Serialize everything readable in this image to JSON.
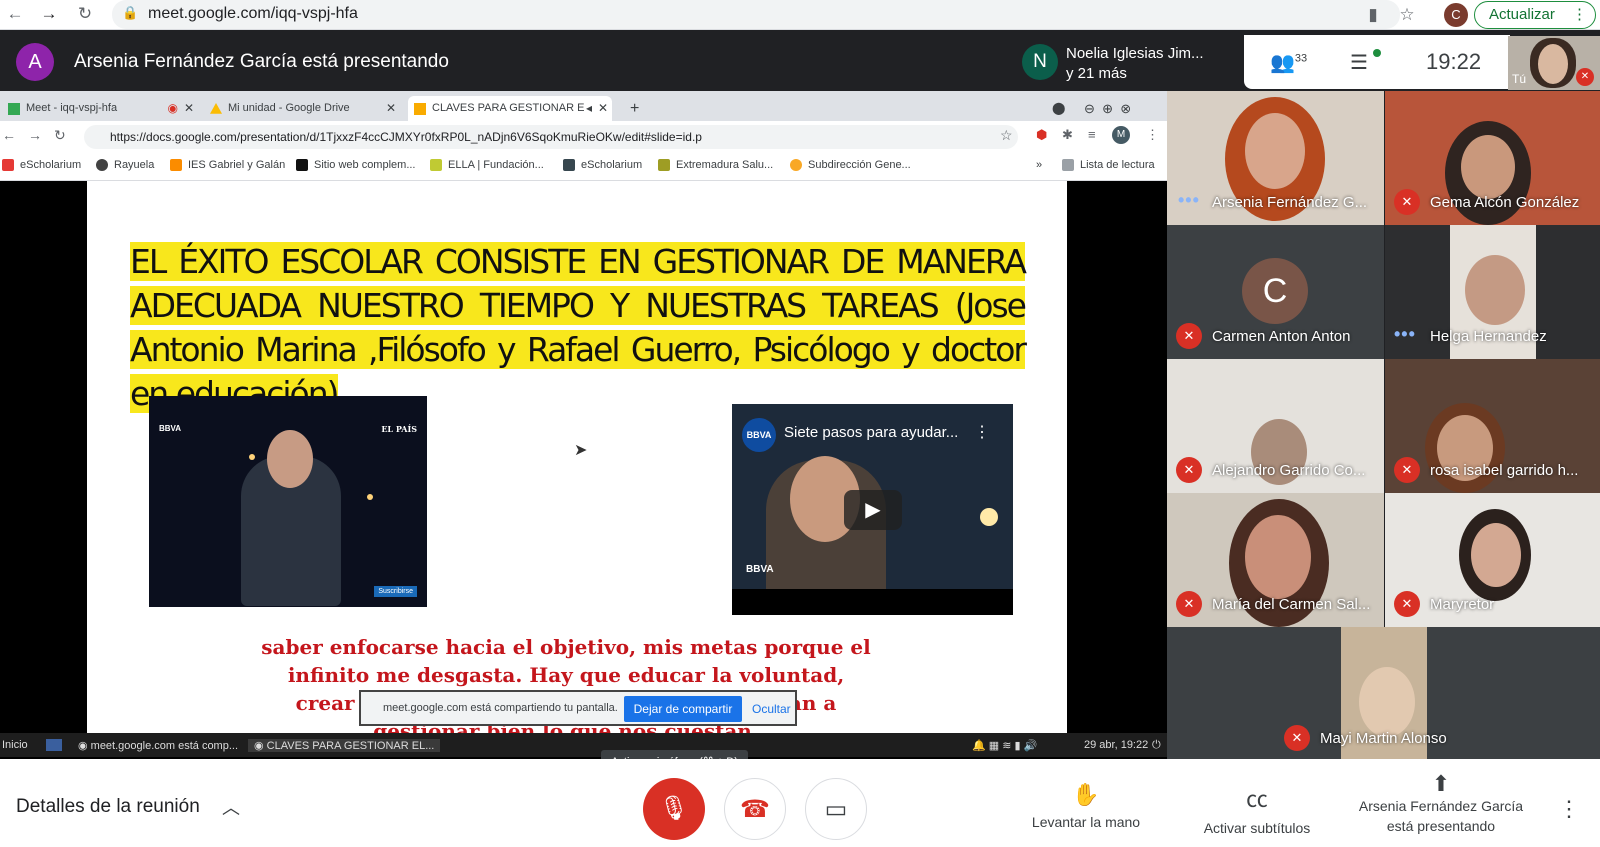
{
  "browser": {
    "url": "meet.google.com/iqq-vspj-hfa",
    "update_button": "Actualizar",
    "profile_initial": "C"
  },
  "meet": {
    "presenter_initial": "A",
    "presenter_text": "Arsenia Fernández García está presentando",
    "pinned": {
      "initial": "N",
      "name": "Noelia Iglesias Jim...",
      "more": "y 21 más"
    },
    "people_count": "33",
    "time": "19:22",
    "self_label": "Tú"
  },
  "shared_screen": {
    "tabs": [
      {
        "label": "Meet - iqq-vspj-hfa",
        "color": "#34a853"
      },
      {
        "label": "Mi unidad - Google Drive",
        "color": "#fbbc04"
      },
      {
        "label": "CLAVES PARA GESTIONAR E",
        "color": "#f9ab00"
      }
    ],
    "url": "https://docs.google.com/presentation/d/1TjxxzF4ccCJMXYr0fxRP0L_nADjn6V6SqoKmuRieOKw/edit#slide=id.p",
    "profile_initial": "M",
    "bookmarks": [
      {
        "label": "eScholarium",
        "color": "#e53935"
      },
      {
        "label": "Rayuela",
        "color": "#424242"
      },
      {
        "label": "IES Gabriel y Galán",
        "color": "#fb8c00"
      },
      {
        "label": "Sitio web complem...",
        "color": "#111111"
      },
      {
        "label": "ELLA | Fundación...",
        "color": "#c0ca33"
      },
      {
        "label": "eScholarium",
        "color": "#37474f"
      },
      {
        "label": "Extremadura Salu...",
        "color": "#9e9d24"
      },
      {
        "label": "Subdirección Gene...",
        "color": "#f9a825"
      }
    ],
    "reading_list": "Lista de lectura",
    "slide": {
      "title": "EL ÉXITO ESCOLAR CONSISTE EN GESTIONAR DE MANERA ADECUADA NUESTRO TIEMPO Y NUESTRAS TAREAS (Jose Antonio Marina ,Filósofo y Rafael Guerro, Psicólogo y doctor en educación)",
      "video1_brand": "BBVA",
      "video1_source": "EL PAÍS",
      "video1_subscribe": "Suscribirse",
      "video2_badge": "BBVA",
      "video2_title": "Siete pasos para ayudar...",
      "video2_brand": "BBVA",
      "quote": "saber enfocarse hacia el objetivo, mis metas porque el infinito me desgasta. Hay que educar la voluntad, crear hábitos y rutinas diarias que nos ayudan a gestionar bien lo que nos cuestan."
    },
    "share_notice": {
      "text": "meet.google.com está compartiendo tu pantalla.",
      "stop": "Dejar de compartir",
      "hide": "Ocultar"
    },
    "taskbar": {
      "start": "Inicio",
      "items": [
        "meet.google.com está comp...",
        "CLAVES PARA GESTIONAR EL..."
      ],
      "datetime": "29 abr, 19:22"
    }
  },
  "tooltip": "Activar micrófono (⌘ + D)",
  "participants": [
    {
      "name": "Arsenia Fernández G...",
      "status": "speaking"
    },
    {
      "name": "Gema Alcón González",
      "status": "muted"
    },
    {
      "name": "Carmen Anton Anton",
      "status": "muted",
      "initial": "C"
    },
    {
      "name": "Helga Hernandez",
      "status": "speaking"
    },
    {
      "name": "Alejandro Garrido Co...",
      "status": "muted"
    },
    {
      "name": "rosa isabel garrido h...",
      "status": "muted"
    },
    {
      "name": "María del Carmen Sal...",
      "status": "muted"
    },
    {
      "name": "Maryretor",
      "status": "muted"
    },
    {
      "name": "Mayi Martin Alonso",
      "status": "muted"
    }
  ],
  "toolbar": {
    "details": "Detalles de la reunión",
    "raise_hand": "Levantar la mano",
    "captions": "Activar subtítulos",
    "presenting": "Arsenia Fernández García está presentando"
  }
}
